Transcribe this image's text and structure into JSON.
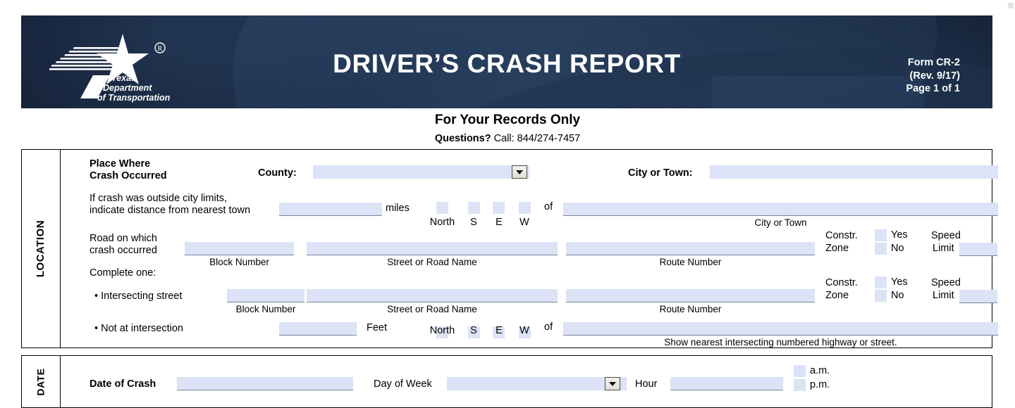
{
  "banner": {
    "title": "DRIVER’S CRASH REPORT",
    "form_no": "Form CR-2",
    "revision": "(Rev. 9/17)",
    "page": "Page 1 of 1",
    "logo_line1": "Texas",
    "logo_line2": "Department",
    "logo_line3": "of Transportation",
    "logo_registered": "®",
    "bg_color": "#1b2b44"
  },
  "subtitle": {
    "line1": "For Your Records Only",
    "line2_bold": "Questions?",
    "line2_rest": " Call: 844/274-7457"
  },
  "location": {
    "section_label": "LOCATION",
    "place_where_line1": "Place Where",
    "place_where_line2": "Crash Occurred",
    "county_label": "County:",
    "county_value": "",
    "city_or_town_label": "City or Town:",
    "city_or_town_value": "",
    "outside_limits_line1": "If crash was outside city limits,",
    "outside_limits_line2": "indicate distance from nearest town",
    "distance_value": "",
    "miles_label": "miles",
    "of_label_1": "of",
    "nearest_town_value": "",
    "nearest_town_caption": "City or Town",
    "directions": [
      "North",
      "S",
      "E",
      "W"
    ],
    "road_line1": "Road on which",
    "road_line2": "crash occurred",
    "road_block_number": "",
    "road_street_name": "",
    "road_route_number": "",
    "caption_block_number": "Block Number",
    "caption_street_name": "Street or Road Name",
    "caption_route_number": "Route Number",
    "constr_line1": "Constr.",
    "constr_line2": "Zone",
    "yes_label": "Yes",
    "no_label": "No",
    "speed_line1": "Speed",
    "speed_line2": "Limit",
    "speed_limit_value_1": "",
    "speed_limit_value_2": "",
    "complete_one": "Complete one:",
    "intersecting_street": "• Intersecting street",
    "inter_block_number": "",
    "inter_street_name": "",
    "inter_route_number": "",
    "not_at_intersection": "• Not at intersection",
    "feet_value": "",
    "feet_label": "Feet",
    "of_label_2": "of",
    "nearest_highway_value": "",
    "nearest_highway_caption": "Show nearest intersecting numbered highway or street."
  },
  "date": {
    "section_label": "DATE",
    "date_of_crash_label": "Date of Crash",
    "date_of_crash_value": "",
    "day_of_week_label": "Day of Week",
    "day_of_week_value": "",
    "hour_label": "Hour",
    "hour_value": "",
    "am_label": "a.m.",
    "pm_label": "p.m."
  }
}
